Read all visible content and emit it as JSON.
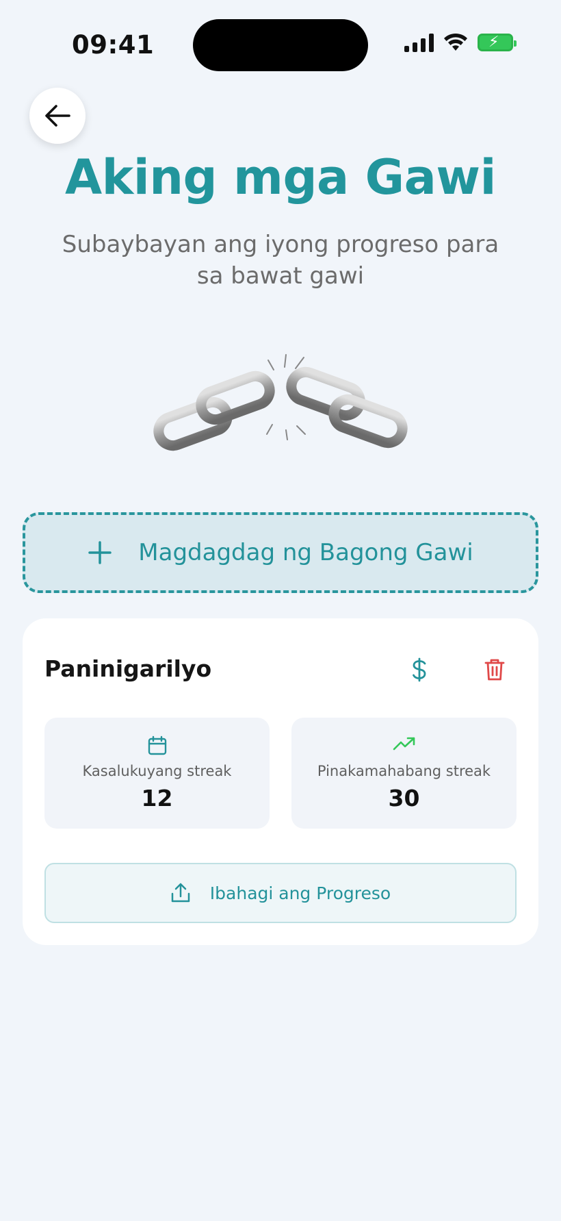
{
  "status_bar": {
    "time": "09:41"
  },
  "header": {
    "title": "Aking mga Gawi",
    "subtitle": "Subaybayan ang iyong progreso para sa bawat gawi"
  },
  "add_button": {
    "label": "Magdagdag ng Bagong Gawi",
    "icon": "plus-icon"
  },
  "habit": {
    "name": "Paninigarilyo",
    "stats": [
      {
        "label": "Kasalukuyang streak",
        "value": "12",
        "icon": "calendar-icon"
      },
      {
        "label": "Pinakamahabang streak",
        "value": "30",
        "icon": "trending-up-icon"
      }
    ],
    "share_label": "Ibahagi ang Progreso"
  },
  "colors": {
    "accent": "#22959c",
    "danger": "#e04848",
    "success": "#34c759",
    "background": "#f1f5fa"
  }
}
